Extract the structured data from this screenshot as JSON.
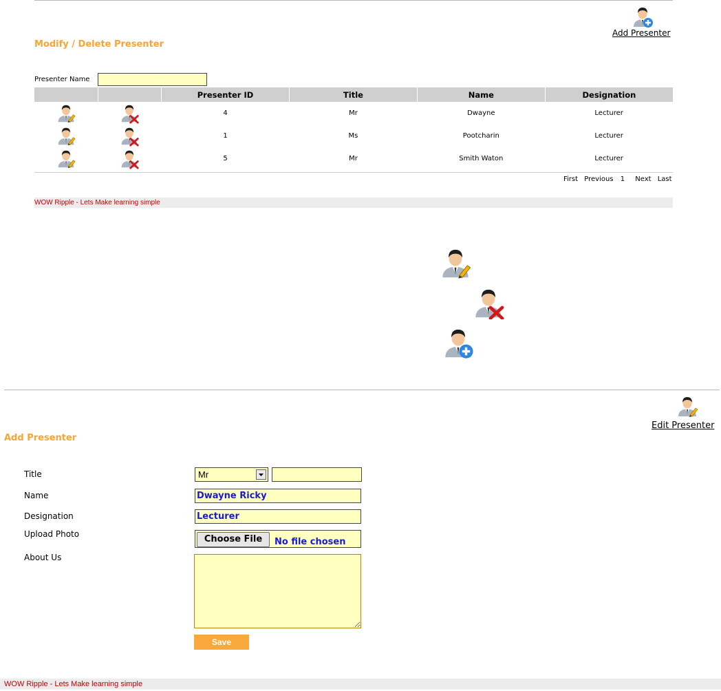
{
  "top": {
    "add_presenter_link": "Add Presenter",
    "section_title": "Modify / Delete Presenter",
    "search_label": "Presenter Name",
    "search_value": "",
    "table": {
      "headers": [
        "",
        "",
        "Presenter ID",
        "Title",
        "Name",
        "Designation"
      ],
      "rows": [
        {
          "id": "4",
          "title": "Mr",
          "name": "Dwayne",
          "designation": "Lecturer"
        },
        {
          "id": "1",
          "title": "Ms",
          "name": "Pootcharin",
          "designation": "Lecturer"
        },
        {
          "id": "5",
          "title": "Mr",
          "name": "Smith Waton",
          "designation": "Lecturer"
        }
      ]
    },
    "pager": {
      "first": "First",
      "previous": "Previous",
      "page": "1",
      "next": "Next",
      "last": "Last"
    },
    "footer": "WOW Ripple - Lets Make learning simple"
  },
  "icons": {
    "edit": "user-edit-icon",
    "delete": "user-delete-icon",
    "add": "user-add-icon"
  },
  "bottom": {
    "edit_presenter_link": "Edit Presenter",
    "section_title": "Add Presenter",
    "labels": {
      "title": "Title",
      "name": "Name",
      "designation": "Designation",
      "upload_photo": "Upload Photo",
      "about_us": "About Us"
    },
    "title_select_value": "Mr",
    "title_extra_value": "",
    "name_value": "Dwayne Ricky",
    "designation_value": "Lecturer",
    "choose_file_label": "Choose File",
    "no_file_text": "No file chosen",
    "about_value": "",
    "save_label": "Save",
    "footer": "WOW Ripple - Lets Make learning simple"
  },
  "colors": {
    "accent_orange": "#f7a535",
    "input_yellow": "#ffffc0",
    "footer_red": "#c00000",
    "value_blue": "#1a1ad4"
  }
}
